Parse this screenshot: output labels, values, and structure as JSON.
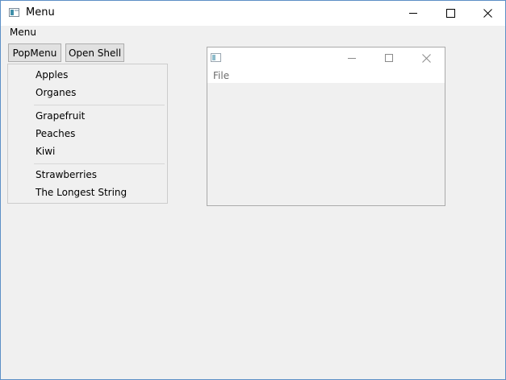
{
  "window": {
    "title": "Menu",
    "icon": "app-window-icon",
    "controls": [
      "minimize-icon",
      "maximize-icon",
      "close-icon"
    ]
  },
  "menubar": {
    "items": [
      "Menu"
    ]
  },
  "buttons": {
    "popmenu": "PopMenu",
    "open_shell": "Open Shell"
  },
  "popup_menu": {
    "items": [
      "Apples",
      "Organes",
      "Grapefruit",
      "Peaches",
      "Kiwi",
      "Strawberries",
      "The Longest String"
    ]
  },
  "shell": {
    "title": "",
    "icon": "app-window-icon",
    "controls": [
      "minimize-icon",
      "maximize-icon",
      "close-icon"
    ],
    "menubar": {
      "items": [
        "File"
      ]
    }
  },
  "colors": {
    "window_border": "#5c8fc6",
    "titlebar": "#ffffff",
    "client_background": "#f0f0f0",
    "button_face": "#e1e1e1",
    "button_border": "#adadad",
    "disabled_text": "#6d6d6d"
  }
}
